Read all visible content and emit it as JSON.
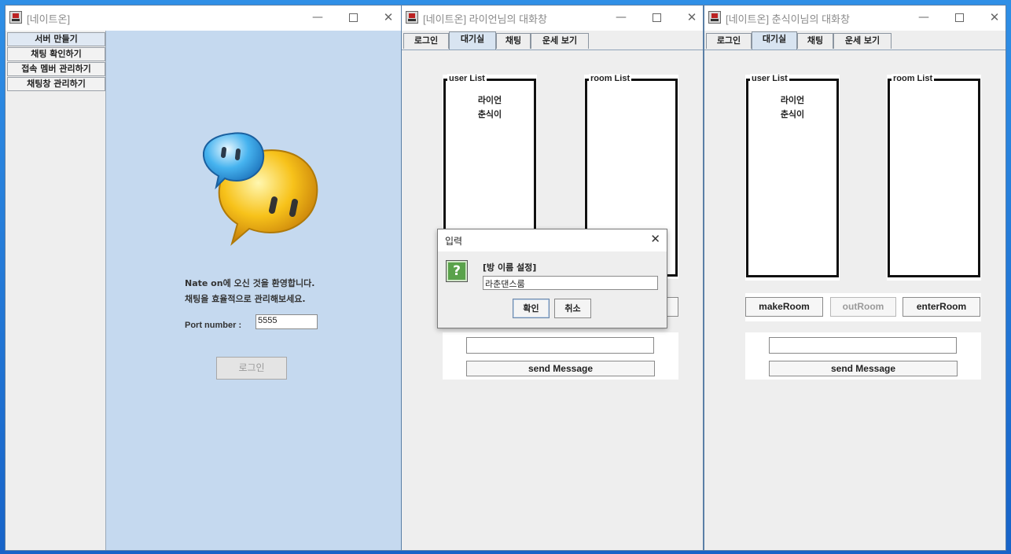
{
  "server_window": {
    "title": "[네이트온]",
    "tabs": [
      "서버 만들기",
      "채팅 확인하기",
      "접속 멤버 관리하기",
      "채팅창 관리하기"
    ],
    "welcome_line1": "Nate on에 오신 것을 환영합니다.",
    "welcome_line2": "채팅을 효율적으로 관리해보세요.",
    "port_label": "Port number :",
    "port_value": "5555",
    "login_button": "로그인"
  },
  "window_controls": {
    "minimize": "—",
    "close": "✕"
  },
  "chat_window_1": {
    "title": "[네이트온] 라이언님의 대화창",
    "tabs": [
      "로그인",
      "대기실",
      "채팅",
      "운세 보기"
    ],
    "selected_tab": "대기실",
    "user_list_label": "user List",
    "users": [
      "라이언",
      "춘식이"
    ],
    "room_list_label": "room List",
    "send_button": "send Message"
  },
  "chat_window_2": {
    "title": "[네이트온] 춘식이님의 대화창",
    "tabs": [
      "로그인",
      "대기실",
      "채팅",
      "운세 보기"
    ],
    "selected_tab": "대기실",
    "user_list_label": "user List",
    "users": [
      "라이언",
      "춘식이"
    ],
    "room_list_label": "room List",
    "make_room_button": "makeRoom",
    "out_room_button": "outRoom",
    "enter_room_button": "enterRoom",
    "send_button": "send Message"
  },
  "input_dialog": {
    "title": "입력",
    "icon_glyph": "?",
    "message": "[방 이름 설정]",
    "value": "라춘댄스룸",
    "ok_button": "확인",
    "cancel_button": "취소"
  },
  "colors": {
    "server_panel_bg": "#c5d9ef",
    "window_bg": "#eeeeee",
    "desktop_bg": "#1f6fd6"
  }
}
